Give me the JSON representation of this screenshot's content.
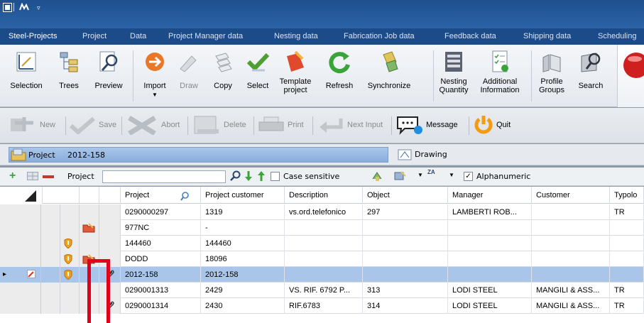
{
  "titlebar": {
    "qat_icons": [
      "app-menu-icon",
      "steel-projects-icon",
      "qat-dropdown-icon"
    ]
  },
  "tabs": [
    {
      "label": "Steel-Projects",
      "active": true
    },
    {
      "label": "Project"
    },
    {
      "label": "Data"
    },
    {
      "label": "Project Manager data"
    },
    {
      "label": "Nesting data"
    },
    {
      "label": "Fabrication Job data"
    },
    {
      "label": "Feedback data"
    },
    {
      "label": "Shipping data"
    },
    {
      "label": "Scheduling"
    }
  ],
  "ribbon": {
    "selection": "Selection",
    "trees": "Trees",
    "preview": "Preview",
    "import": "Import",
    "draw": "Draw",
    "copy": "Copy",
    "select": "Select",
    "template_1": "Template",
    "template_2": "project",
    "refresh": "Refresh",
    "synchronize": "Synchronize",
    "nesting_1": "Nesting",
    "nesting_2": "Quantity",
    "additional_1": "Additional",
    "additional_2": "Information",
    "profile_1": "Profile",
    "profile_2": "Groups",
    "search": "Search"
  },
  "actions": {
    "new": "New",
    "save": "Save",
    "abort": "Abort",
    "delete": "Delete",
    "print": "Print",
    "next_input": "Next Input",
    "message": "Message",
    "quit": "Quit"
  },
  "panels": {
    "project_label": "Project",
    "project_number": "2012-158",
    "drawing_label": "Drawing"
  },
  "filter": {
    "label": "Project",
    "value": "",
    "case_sensitive": "Case sensitive",
    "case_checked": false,
    "sort_glyph": "ZA",
    "alphanumeric": "Alphanumeric",
    "alpha_checked": true
  },
  "grid": {
    "columns": [
      "Project",
      "Project customer",
      "Description",
      "Object",
      "Manager",
      "Customer",
      "Typolo"
    ],
    "rows": [
      {
        "cells": [
          "0290000297",
          "1319",
          "vs.ord.telefonico",
          "297",
          "LAMBERTI ROB...",
          "",
          "TR"
        ],
        "shield": false,
        "folder": false,
        "clip": false,
        "selected": false
      },
      {
        "cells": [
          "977NC",
          "-",
          "",
          "",
          "",
          "",
          ""
        ],
        "shield": false,
        "folder": true,
        "clip": false,
        "selected": false
      },
      {
        "cells": [
          "144460",
          "144460",
          "",
          "",
          "",
          "",
          ""
        ],
        "shield": true,
        "folder": false,
        "clip": false,
        "selected": false
      },
      {
        "cells": [
          "DODD",
          "18096",
          "",
          "",
          "",
          "",
          ""
        ],
        "shield": true,
        "folder": true,
        "clip": false,
        "selected": false
      },
      {
        "cells": [
          "2012-158",
          "2012-158",
          "",
          "",
          "",
          "",
          ""
        ],
        "shield": true,
        "folder": false,
        "clip": true,
        "selected": true,
        "arrow": "▸",
        "edit": true
      },
      {
        "cells": [
          "0290001313",
          "2429",
          "VS. RIF. 6792 P...",
          "313",
          "LODI STEEL",
          "MANGILI & ASS...",
          "TR"
        ],
        "shield": false,
        "folder": false,
        "clip": false,
        "selected": false
      },
      {
        "cells": [
          "0290001314",
          "2430",
          "RIF.6783",
          "314",
          "LODI STEEL",
          "MANGILI & ASS...",
          "TR"
        ],
        "shield": false,
        "folder": false,
        "clip": true,
        "selected": false
      }
    ]
  },
  "colors": {
    "accent": "#2c64a8",
    "selection": "#a9c6ea",
    "highlight": "#e0001b",
    "refresh": "#3aa33a",
    "quit": "#f39c12"
  }
}
